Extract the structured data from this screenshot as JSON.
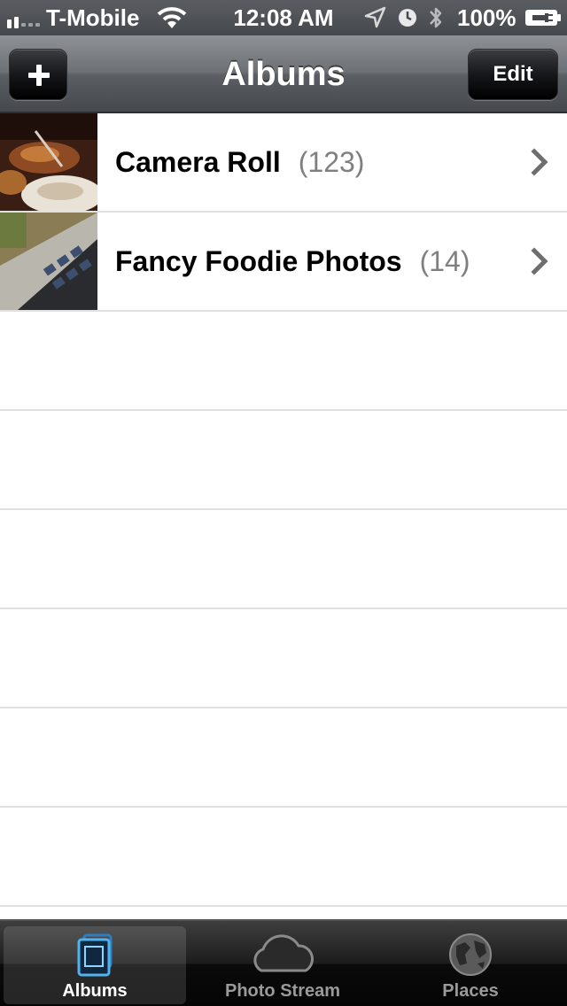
{
  "status_bar": {
    "carrier": "T-Mobile",
    "time": "12:08 AM",
    "battery": "100%"
  },
  "nav": {
    "title": "Albums",
    "add_icon": "plus-icon",
    "edit_label": "Edit"
  },
  "albums": [
    {
      "name": "Camera Roll",
      "count": "(123)",
      "thumbnail": "dinner-plates-photo"
    },
    {
      "name": "Fancy Foodie Photos",
      "count": "(14)",
      "thumbnail": "laptop-keyboard-photo"
    }
  ],
  "tabs": [
    {
      "label": "Albums",
      "icon": "albums-icon",
      "selected": true
    },
    {
      "label": "Photo Stream",
      "icon": "cloud-icon",
      "selected": false
    },
    {
      "label": "Places",
      "icon": "globe-icon",
      "selected": false
    }
  ],
  "colors": {
    "accent_blue": "#4fb4f0",
    "count_gray": "#7f7f7f",
    "separator": "#e0e0e0"
  }
}
